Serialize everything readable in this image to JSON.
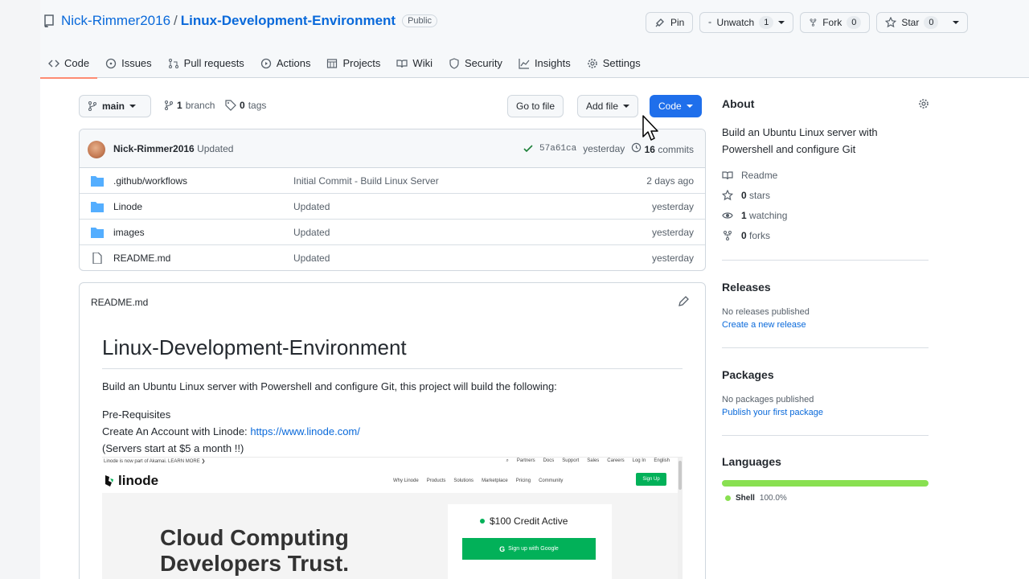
{
  "repo": {
    "owner": "Nick-Rimmer2016",
    "separator": "/",
    "name": "Linux-Development-Environment",
    "visibility": "Public"
  },
  "actions": {
    "pin": "Pin",
    "unwatch": "Unwatch",
    "unwatch_count": "1",
    "fork": "Fork",
    "fork_count": "0",
    "star": "Star",
    "star_count": "0"
  },
  "tabs": [
    {
      "label": "Code",
      "icon": "code-icon"
    },
    {
      "label": "Issues",
      "icon": "issues-icon"
    },
    {
      "label": "Pull requests",
      "icon": "pull-request-icon"
    },
    {
      "label": "Actions",
      "icon": "play-icon"
    },
    {
      "label": "Projects",
      "icon": "table-icon"
    },
    {
      "label": "Wiki",
      "icon": "book-icon"
    },
    {
      "label": "Security",
      "icon": "shield-icon"
    },
    {
      "label": "Insights",
      "icon": "graph-icon"
    },
    {
      "label": "Settings",
      "icon": "gear-icon"
    }
  ],
  "toolbar": {
    "branch": "main",
    "branches_count": "1",
    "branches_label": "branch",
    "tags_count": "0",
    "tags_label": "tags",
    "goto_file": "Go to file",
    "add_file": "Add file",
    "code": "Code"
  },
  "commit": {
    "author": "Nick-Rimmer2016",
    "message": "Updated",
    "sha": "57a61ca",
    "date": "yesterday",
    "commits_count": "16",
    "commits_label": "commits"
  },
  "files": [
    {
      "type": "folder",
      "name": ".github/workflows",
      "message": "Initial Commit - Build Linux Server",
      "date": "2 days ago"
    },
    {
      "type": "folder",
      "name": "Linode",
      "message": "Updated",
      "date": "yesterday"
    },
    {
      "type": "folder",
      "name": "images",
      "message": "Updated",
      "date": "yesterday"
    },
    {
      "type": "file",
      "name": "README.md",
      "message": "Updated",
      "date": "yesterday"
    }
  ],
  "readme": {
    "filename": "README.md",
    "title": "Linux-Development-Environment",
    "intro": "Build an Ubuntu Linux server with Powershell and configure Git, this project will build the following:",
    "prereq_heading": "Pre-Requisites",
    "account_text": "Create An Account with Linode:",
    "account_link": "https://www.linode.com/",
    "price_note": "(Servers start at $5 a month !!)"
  },
  "linode_shot": {
    "banner": "Linode is now part of Akamai. LEARN MORE ❯",
    "top_links": [
      "Partners",
      "Docs",
      "Support",
      "Sales",
      "Careers",
      "Log In",
      "English"
    ],
    "logo": "linode",
    "menu": [
      "Why Linode",
      "Products",
      "Solutions",
      "Marketplace",
      "Pricing",
      "Community"
    ],
    "signup": "Sign Up",
    "hero_line1": "Cloud Computing",
    "hero_line2": "Developers Trust.",
    "credit": "$100 Credit Active",
    "google_signup": "Sign up with Google"
  },
  "about": {
    "heading": "About",
    "description": "Build an Ubuntu Linux server with Powershell and configure Git",
    "readme": "Readme",
    "stars_count": "0",
    "stars_label": "stars",
    "watching_count": "1",
    "watching_label": "watching",
    "forks_count": "0",
    "forks_label": "forks"
  },
  "releases": {
    "heading": "Releases",
    "none": "No releases published",
    "link": "Create a new release"
  },
  "packages": {
    "heading": "Packages",
    "none": "No packages published",
    "link": "Publish your first package"
  },
  "languages": {
    "heading": "Languages",
    "items": [
      {
        "name": "Shell",
        "percent": "100.0%",
        "fraction": 1.0,
        "color": "#89e051"
      }
    ]
  },
  "colors": {
    "accent": "#0969da",
    "code_button": "#1f6feb",
    "linode_green": "#02b159",
    "active_tab_underline": "#fd8c73"
  }
}
